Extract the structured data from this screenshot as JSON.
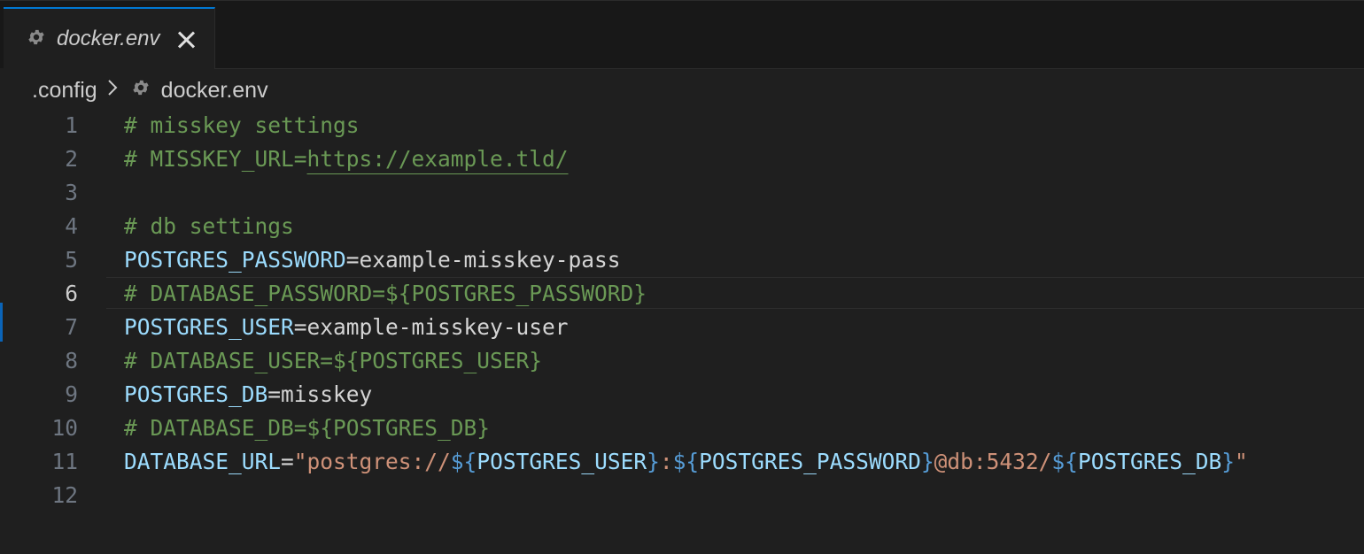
{
  "tab": {
    "label": "docker.env",
    "icon": "gear-icon"
  },
  "breadcrumb": {
    "folder": ".config",
    "separator": ">",
    "file": "docker.env",
    "file_icon": "gear-icon"
  },
  "editor": {
    "active_line": 6,
    "lines": [
      {
        "n": "1",
        "parts": [
          {
            "t": "# misskey settings",
            "c": "comment"
          }
        ]
      },
      {
        "n": "2",
        "parts": [
          {
            "t": "# MISSKEY_URL=",
            "c": "comment"
          },
          {
            "t": "https://example.tld/",
            "c": "link"
          }
        ]
      },
      {
        "n": "3",
        "parts": []
      },
      {
        "n": "4",
        "parts": [
          {
            "t": "# db settings",
            "c": "comment"
          }
        ]
      },
      {
        "n": "5",
        "parts": [
          {
            "t": "POSTGRES_PASSWORD",
            "c": "key"
          },
          {
            "t": "=example-misskey-pass",
            "c": "plain"
          }
        ]
      },
      {
        "n": "6",
        "parts": [
          {
            "t": "# DATABASE_PASSWORD=${POSTGRES_PASSWORD}",
            "c": "comment"
          }
        ]
      },
      {
        "n": "7",
        "parts": [
          {
            "t": "POSTGRES_USER",
            "c": "key"
          },
          {
            "t": "=example-misskey-user",
            "c": "plain"
          }
        ]
      },
      {
        "n": "8",
        "parts": [
          {
            "t": "# DATABASE_USER=${POSTGRES_USER}",
            "c": "comment"
          }
        ]
      },
      {
        "n": "9",
        "parts": [
          {
            "t": "POSTGRES_DB",
            "c": "key"
          },
          {
            "t": "=misskey",
            "c": "plain"
          }
        ]
      },
      {
        "n": "10",
        "parts": [
          {
            "t": "# DATABASE_DB=${POSTGRES_DB}",
            "c": "comment"
          }
        ]
      },
      {
        "n": "11",
        "parts": [
          {
            "t": "DATABASE_URL",
            "c": "key"
          },
          {
            "t": "=",
            "c": "plain"
          },
          {
            "t": "\"postgres://",
            "c": "str"
          },
          {
            "t": "${",
            "c": "brace"
          },
          {
            "t": "POSTGRES_USER",
            "c": "var"
          },
          {
            "t": "}",
            "c": "brace"
          },
          {
            "t": ":",
            "c": "str"
          },
          {
            "t": "${",
            "c": "brace"
          },
          {
            "t": "POSTGRES_PASSWORD",
            "c": "var"
          },
          {
            "t": "}",
            "c": "brace"
          },
          {
            "t": "@db:5432/",
            "c": "str"
          },
          {
            "t": "${",
            "c": "brace"
          },
          {
            "t": "POSTGRES_DB",
            "c": "var"
          },
          {
            "t": "}",
            "c": "brace"
          },
          {
            "t": "\"",
            "c": "str"
          }
        ]
      },
      {
        "n": "12",
        "parts": []
      }
    ]
  },
  "colors": {
    "background": "#1f1f1f",
    "comment": "#6a9955",
    "key": "#9cdcfe",
    "string": "#ce9178",
    "brace": "#569cd6",
    "accent": "#0078d4"
  }
}
